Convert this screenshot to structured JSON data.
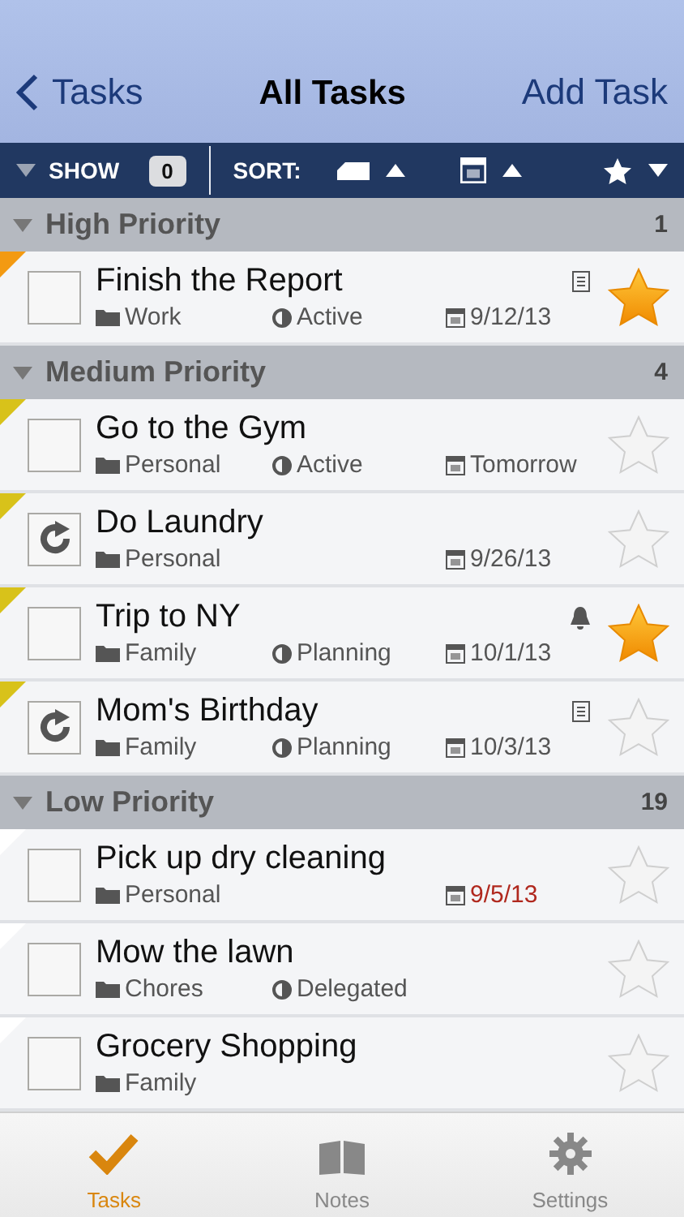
{
  "nav": {
    "back": "Tasks",
    "title": "All Tasks",
    "action": "Add Task"
  },
  "toolbar": {
    "show": "SHOW",
    "show_count": "0",
    "sort": "SORT:",
    "sort_keys": [
      {
        "kind": "priority",
        "descending": false
      },
      {
        "kind": "date",
        "descending": false
      },
      {
        "kind": "star",
        "descending": true
      }
    ]
  },
  "sections": [
    {
      "title": "High Priority",
      "count": "1",
      "color": "#f39a12",
      "expanded": true,
      "tasks": [
        {
          "kind": "check",
          "title": "Finish the Report",
          "folder": "Work",
          "status": "Active",
          "date": "9/12/13",
          "overdue": false,
          "has_note": true,
          "starred": true
        }
      ]
    },
    {
      "title": "Medium Priority",
      "count": "4",
      "color": "#d8c21a",
      "expanded": true,
      "tasks": [
        {
          "kind": "check",
          "title": "Go to the Gym",
          "folder": "Personal",
          "status": "Active",
          "date": "Tomorrow",
          "overdue": false,
          "starred": false
        },
        {
          "kind": "repeat",
          "title": "Do Laundry",
          "folder": "Personal",
          "date": "9/26/13",
          "overdue": false,
          "starred": false
        },
        {
          "kind": "check",
          "title": "Trip to NY",
          "folder": "Family",
          "status": "Planning",
          "date": "10/1/13",
          "overdue": false,
          "has_alarm": true,
          "starred": true
        },
        {
          "kind": "repeat",
          "title": "Mom's Birthday",
          "folder": "Family",
          "status": "Planning",
          "date": "10/3/13",
          "overdue": false,
          "has_note": true,
          "starred": false
        }
      ]
    },
    {
      "title": "Low Priority",
      "count": "19",
      "color": "#ffffff",
      "expanded": true,
      "tasks": [
        {
          "kind": "check",
          "title": "Pick up dry cleaning",
          "folder": "Personal",
          "date": "9/5/13",
          "overdue": true,
          "starred": false
        },
        {
          "kind": "check",
          "title": "Mow the lawn",
          "folder": "Chores",
          "status": "Delegated",
          "starred": false
        },
        {
          "kind": "check",
          "title": "Grocery Shopping",
          "folder": "Family",
          "starred": false
        }
      ]
    }
  ],
  "tabbar": [
    {
      "kind": "tasks",
      "label": "Tasks",
      "selected": true
    },
    {
      "kind": "notes",
      "label": "Notes",
      "selected": false
    },
    {
      "kind": "settings",
      "label": "Settings",
      "selected": false
    }
  ]
}
